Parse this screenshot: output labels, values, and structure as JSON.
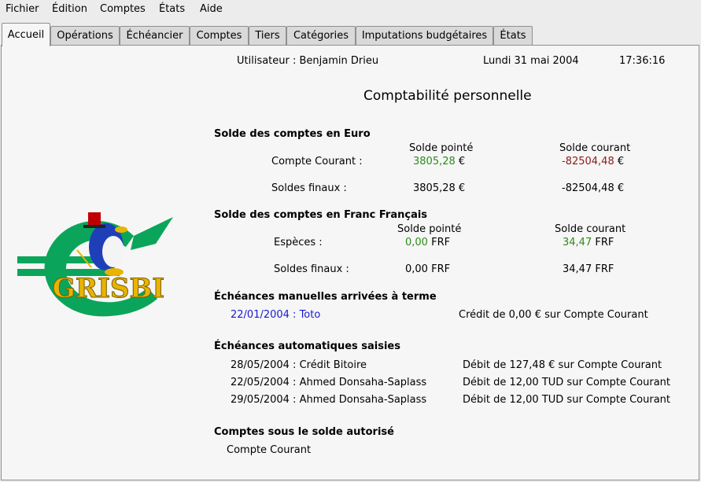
{
  "menu": [
    "Fichier",
    "Édition",
    "Comptes",
    "États",
    "Aide"
  ],
  "tabs": [
    "Accueil",
    "Opérations",
    "Échéancier",
    "Comptes",
    "Tiers",
    "Catégories",
    "Imputations budgétaires",
    "États"
  ],
  "active_tab": "Accueil",
  "header": {
    "user": "Utilisateur : Benjamin Drieu",
    "date": "Lundi 31 mai 2004",
    "time": "17:36:16"
  },
  "title": "Comptabilité personnelle",
  "logo": {
    "text": "GRISBI"
  },
  "euro": {
    "title": "Solde des comptes en Euro",
    "col_pointe": "Solde pointé",
    "col_courant": "Solde courant",
    "accounts": [
      {
        "name": "Compte Courant :",
        "pointe": "3805,28",
        "courant": "-82504,48",
        "currency": "€"
      }
    ],
    "totals": {
      "label": "Soldes finaux :",
      "pointe": "3805,28",
      "courant": "-82504,48",
      "currency": "€"
    }
  },
  "frf": {
    "title": "Solde des comptes en Franc Français",
    "col_pointe": "Solde pointé",
    "col_courant": "Solde courant",
    "accounts": [
      {
        "name": "Espèces :",
        "pointe": "0,00",
        "courant": "34,47",
        "currency": "FRF"
      }
    ],
    "totals": {
      "label": "Soldes finaux :",
      "pointe": "0,00",
      "courant": "34,47",
      "currency": "FRF"
    }
  },
  "manual": {
    "title": "Échéances manuelles arrivées à terme",
    "items": [
      {
        "label": "22/01/2004 : Toto",
        "desc": "Crédit de 0,00 € sur Compte Courant"
      }
    ]
  },
  "auto": {
    "title": "Échéances automatiques saisies",
    "items": [
      {
        "label": "28/05/2004 : Crédit Bitoire",
        "desc": "Débit de 127,48 € sur Compte Courant"
      },
      {
        "label": "22/05/2004 : Ahmed Donsaha-Saplass",
        "desc": "Débit de 12,00 TUD sur Compte Courant"
      },
      {
        "label": "29/05/2004 : Ahmed Donsaha-Saplass",
        "desc": "Débit de 12,00 TUD sur Compte Courant"
      }
    ]
  },
  "below": {
    "title": "Comptes sous le solde autorisé",
    "items": [
      "Compte Courant"
    ]
  },
  "colors": {
    "positive": "#2e8b1a",
    "negative": "#8b1a1a",
    "link": "#1a1ad1",
    "logo_green": "#0aa55a",
    "logo_gold": "#e8b400"
  }
}
